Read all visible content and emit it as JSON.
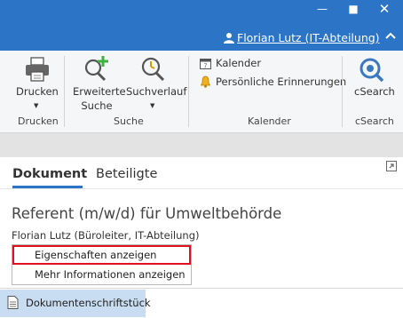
{
  "titlebar": {
    "minimize_glyph": "—",
    "maximize_glyph": "■",
    "close_glyph": "✕",
    "user_name": "Florian Lutz (IT-Abteilung)"
  },
  "ribbon": {
    "drucken": {
      "button_label": "Drucken",
      "group_label": "Drucken"
    },
    "suche": {
      "erweiterte_line1": "Erweiterte",
      "erweiterte_line2": "Suche",
      "suchverlauf_label": "Suchverlauf",
      "group_label": "Suche"
    },
    "kalender": {
      "kalender_label": "Kalender",
      "erinnerungen_label": "Persönliche Erinnerungen",
      "group_label": "Kalender"
    },
    "csearch": {
      "button_label": "cSearch",
      "group_label": "cSearch"
    }
  },
  "content": {
    "tabs": [
      {
        "label": "Dokument",
        "active": true
      },
      {
        "label": "Beteiligte",
        "active": false
      }
    ],
    "document_title": "Referent (m/w/d) für Umweltbehörde",
    "author_line": "Florian Lutz (Büroleiter, IT-Abteilung)",
    "context_menu": [
      {
        "label": "Eigenschaften anzeigen",
        "highlighted": true
      },
      {
        "label": "Mehr Informationen anzeigen",
        "highlighted": false
      }
    ]
  },
  "bottom": {
    "item_label": "Dokumentenschriftstück"
  },
  "colors": {
    "accent": "#2b74c6",
    "highlight": "#e0101a",
    "bottom_item_bg": "#c9ddf2"
  }
}
